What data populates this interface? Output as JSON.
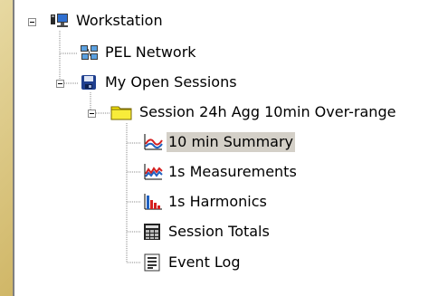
{
  "tree": {
    "root": {
      "label": "Workstation",
      "icon": "workstation-icon",
      "expanded": true
    },
    "pel_network": {
      "label": "PEL Network",
      "icon": "network-icon"
    },
    "sessions": {
      "label": "My Open Sessions",
      "icon": "sessions-icon",
      "expanded": true
    },
    "session": {
      "label": "Session 24h Agg 10min Over-range",
      "icon": "folder-icon",
      "expanded": true
    },
    "children": [
      {
        "label": "10 min Summary",
        "icon": "trend-chart-icon",
        "selected": true
      },
      {
        "label": "1s Measurements",
        "icon": "measurement-chart-icon",
        "selected": false
      },
      {
        "label": "1s Harmonics",
        "icon": "harmonics-chart-icon",
        "selected": false
      },
      {
        "label": "Session Totals",
        "icon": "totals-table-icon",
        "selected": false
      },
      {
        "label": "Event Log",
        "icon": "event-log-icon",
        "selected": false
      }
    ]
  },
  "colors": {
    "selection": "#d4d0c8",
    "folder": "#f6e40a",
    "tree_lines": "#8a8a8a"
  }
}
